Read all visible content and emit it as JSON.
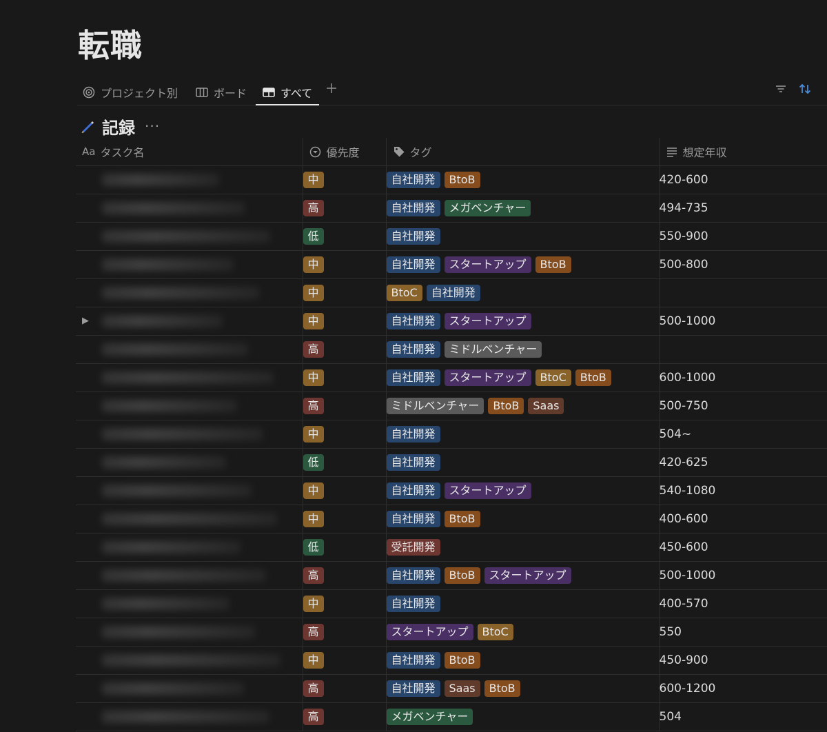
{
  "page": {
    "title": "転職"
  },
  "tabs": [
    {
      "label": "プロジェクト別",
      "icon": "target-icon"
    },
    {
      "label": "ボード",
      "icon": "board-icon"
    },
    {
      "label": "すべて",
      "icon": "table-icon",
      "active": true
    }
  ],
  "section": {
    "icon": "pencil-icon",
    "title": "記録",
    "more": "···"
  },
  "columns": {
    "name": {
      "icon_text": "Aa",
      "label": "タスク名"
    },
    "priority": {
      "label": "優先度"
    },
    "tags": {
      "label": "タグ"
    },
    "salary": {
      "label": "想定年収"
    }
  },
  "colors": {
    "高": "#6e3630",
    "中": "#89632a",
    "低": "#2b593f",
    "自社開発": "#28456c",
    "BtoB": "#854c1d",
    "BtoC": "#89632a",
    "メガベンチャー": "#2b593f",
    "スタートアップ": "#492f64",
    "ミドルベンチャー": "#5a5a5a",
    "Saas": "#603b2c",
    "受託開発": "#6e3630"
  },
  "rows": [
    {
      "priority": "中",
      "tags": [
        "自社開発",
        "BtoB"
      ],
      "salary": "420-600"
    },
    {
      "priority": "高",
      "tags": [
        "自社開発",
        "メガベンチャー"
      ],
      "salary": "494-735"
    },
    {
      "priority": "低",
      "tags": [
        "自社開発"
      ],
      "salary": "550-900"
    },
    {
      "priority": "中",
      "tags": [
        "自社開発",
        "スタートアップ",
        "BtoB"
      ],
      "salary": "500-800"
    },
    {
      "priority": "中",
      "tags": [
        "BtoC",
        "自社開発"
      ],
      "salary": ""
    },
    {
      "priority": "中",
      "tags": [
        "自社開発",
        "スタートアップ"
      ],
      "salary": "500-1000",
      "expandable": true
    },
    {
      "priority": "高",
      "tags": [
        "自社開発",
        "ミドルベンチャー"
      ],
      "salary": ""
    },
    {
      "priority": "中",
      "tags": [
        "自社開発",
        "スタートアップ",
        "BtoC",
        "BtoB"
      ],
      "salary": "600-1000"
    },
    {
      "priority": "高",
      "tags": [
        "ミドルベンチャー",
        "BtoB",
        "Saas"
      ],
      "salary": "500-750"
    },
    {
      "priority": "中",
      "tags": [
        "自社開発"
      ],
      "salary": "504~"
    },
    {
      "priority": "低",
      "tags": [
        "自社開発"
      ],
      "salary": "420-625"
    },
    {
      "priority": "中",
      "tags": [
        "自社開発",
        "スタートアップ"
      ],
      "salary": "540-1080"
    },
    {
      "priority": "中",
      "tags": [
        "自社開発",
        "BtoB"
      ],
      "salary": "400-600"
    },
    {
      "priority": "低",
      "tags": [
        "受託開発"
      ],
      "salary": "450-600"
    },
    {
      "priority": "高",
      "tags": [
        "自社開発",
        "BtoB",
        "スタートアップ"
      ],
      "salary": "500-1000"
    },
    {
      "priority": "中",
      "tags": [
        "自社開発"
      ],
      "salary": "400-570"
    },
    {
      "priority": "高",
      "tags": [
        "スタートアップ",
        "BtoC"
      ],
      "salary": "550"
    },
    {
      "priority": "中",
      "tags": [
        "自社開発",
        "BtoB"
      ],
      "salary": "450-900"
    },
    {
      "priority": "高",
      "tags": [
        "自社開発",
        "Saas",
        "BtoB"
      ],
      "salary": "600-1200"
    },
    {
      "priority": "高",
      "tags": [
        "メガベンチャー"
      ],
      "salary": "504"
    }
  ]
}
